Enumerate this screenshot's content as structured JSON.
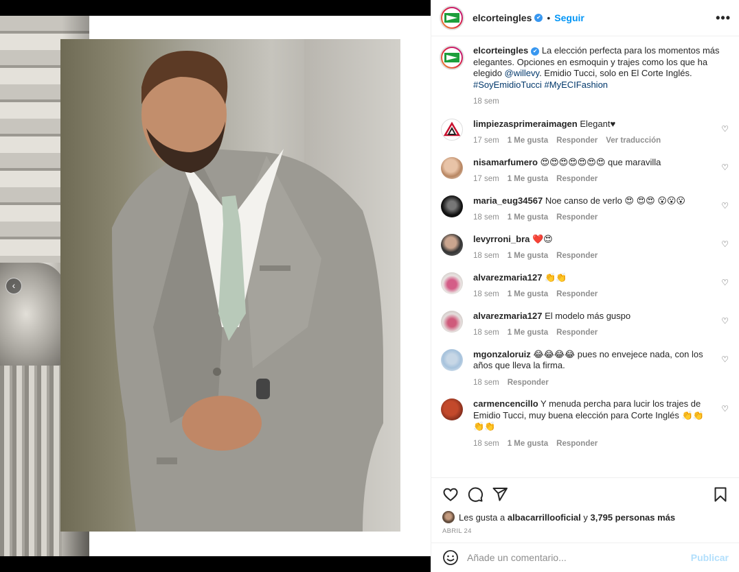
{
  "post": {
    "username": "elcorteingles",
    "follow_label": "Seguir",
    "separator": "•",
    "more_label": "•••",
    "caption_text": "La elección perfecta para los momentos más elegantes. Opciones en esmoquin y trajes como los que ha elegido ",
    "caption_mention": "@willevy",
    "caption_text2": ". Emidio Tucci, solo en El Corte Inglés.",
    "caption_hashtags": "#SoyEmidioTucci #MyECIFashion",
    "caption_time": "18 sem"
  },
  "comments": [
    {
      "user": "limpiezasprimeraimagen",
      "text": "Elegant♥",
      "time": "17 sem",
      "likes": "1 Me gusta",
      "reply": "Responder",
      "translate": "Ver traducción"
    },
    {
      "user": "nisamarfumero",
      "text": "😍😍😍😍😍😍😍 que maravilla",
      "time": "17 sem",
      "likes": "1 Me gusta",
      "reply": "Responder"
    },
    {
      "user": "maria_eug34567",
      "text": "Noe canso de verlo 😍 😍😍 😮😮😮",
      "time": "18 sem",
      "likes": "1 Me gusta",
      "reply": "Responder"
    },
    {
      "user": "levyrroni_bra",
      "text": "❤️😍",
      "time": "18 sem",
      "likes": "1 Me gusta",
      "reply": "Responder"
    },
    {
      "user": "alvarezmaria127",
      "text": "👏👏",
      "time": "18 sem",
      "likes": "1 Me gusta",
      "reply": "Responder"
    },
    {
      "user": "alvarezmaria127",
      "text": "El modelo más guspo",
      "time": "18 sem",
      "likes": "1 Me gusta",
      "reply": "Responder"
    },
    {
      "user": "mgonzaloruiz",
      "text": "😂😂😂😂 pues no envejece nada, con los años que lleva la firma.",
      "time": "18 sem",
      "reply": "Responder"
    },
    {
      "user": "carmencencillo",
      "text": "Y menuda percha para lucir los trajes de Emidio Tucci, muy buena elección para Corte Inglés 👏👏👏👏",
      "time": "18 sem",
      "likes": "1 Me gusta",
      "reply": "Responder"
    }
  ],
  "likes": {
    "prefix": "Les gusta a",
    "user": "albacarrillooficial",
    "connector": "y",
    "count_text": "3,795 personas más"
  },
  "date": "ABRIL 24",
  "add_comment": {
    "placeholder": "Añade un comentario...",
    "publish_label": "Publicar"
  },
  "icons": [
    "heart-icon",
    "comment-icon",
    "share-icon",
    "bookmark-icon",
    "emoji-icon",
    "verified-icon",
    "more-icon",
    "chevron-left-icon"
  ],
  "colors": {
    "accent": "#0095f6",
    "brand_green": "#1c9e3b",
    "muted": "#8e8e8e",
    "publish_disabled": "#b2dffc"
  }
}
